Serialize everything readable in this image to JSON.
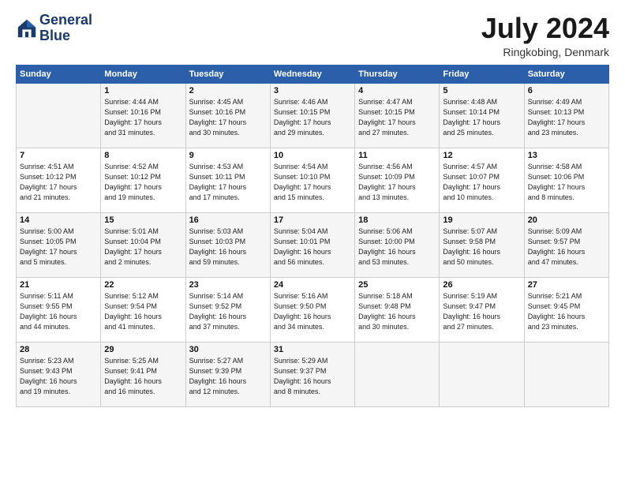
{
  "logo": {
    "line1": "General",
    "line2": "Blue"
  },
  "title": "July 2024",
  "location": "Ringkobing, Denmark",
  "header_days": [
    "Sunday",
    "Monday",
    "Tuesday",
    "Wednesday",
    "Thursday",
    "Friday",
    "Saturday"
  ],
  "weeks": [
    [
      {
        "day": "",
        "info": ""
      },
      {
        "day": "1",
        "info": "Sunrise: 4:44 AM\nSunset: 10:16 PM\nDaylight: 17 hours\nand 31 minutes."
      },
      {
        "day": "2",
        "info": "Sunrise: 4:45 AM\nSunset: 10:16 PM\nDaylight: 17 hours\nand 30 minutes."
      },
      {
        "day": "3",
        "info": "Sunrise: 4:46 AM\nSunset: 10:15 PM\nDaylight: 17 hours\nand 29 minutes."
      },
      {
        "day": "4",
        "info": "Sunrise: 4:47 AM\nSunset: 10:15 PM\nDaylight: 17 hours\nand 27 minutes."
      },
      {
        "day": "5",
        "info": "Sunrise: 4:48 AM\nSunset: 10:14 PM\nDaylight: 17 hours\nand 25 minutes."
      },
      {
        "day": "6",
        "info": "Sunrise: 4:49 AM\nSunset: 10:13 PM\nDaylight: 17 hours\nand 23 minutes."
      }
    ],
    [
      {
        "day": "7",
        "info": "Sunrise: 4:51 AM\nSunset: 10:12 PM\nDaylight: 17 hours\nand 21 minutes."
      },
      {
        "day": "8",
        "info": "Sunrise: 4:52 AM\nSunset: 10:12 PM\nDaylight: 17 hours\nand 19 minutes."
      },
      {
        "day": "9",
        "info": "Sunrise: 4:53 AM\nSunset: 10:11 PM\nDaylight: 17 hours\nand 17 minutes."
      },
      {
        "day": "10",
        "info": "Sunrise: 4:54 AM\nSunset: 10:10 PM\nDaylight: 17 hours\nand 15 minutes."
      },
      {
        "day": "11",
        "info": "Sunrise: 4:56 AM\nSunset: 10:09 PM\nDaylight: 17 hours\nand 13 minutes."
      },
      {
        "day": "12",
        "info": "Sunrise: 4:57 AM\nSunset: 10:07 PM\nDaylight: 17 hours\nand 10 minutes."
      },
      {
        "day": "13",
        "info": "Sunrise: 4:58 AM\nSunset: 10:06 PM\nDaylight: 17 hours\nand 8 minutes."
      }
    ],
    [
      {
        "day": "14",
        "info": "Sunrise: 5:00 AM\nSunset: 10:05 PM\nDaylight: 17 hours\nand 5 minutes."
      },
      {
        "day": "15",
        "info": "Sunrise: 5:01 AM\nSunset: 10:04 PM\nDaylight: 17 hours\nand 2 minutes."
      },
      {
        "day": "16",
        "info": "Sunrise: 5:03 AM\nSunset: 10:03 PM\nDaylight: 16 hours\nand 59 minutes."
      },
      {
        "day": "17",
        "info": "Sunrise: 5:04 AM\nSunset: 10:01 PM\nDaylight: 16 hours\nand 56 minutes."
      },
      {
        "day": "18",
        "info": "Sunrise: 5:06 AM\nSunset: 10:00 PM\nDaylight: 16 hours\nand 53 minutes."
      },
      {
        "day": "19",
        "info": "Sunrise: 5:07 AM\nSunset: 9:58 PM\nDaylight: 16 hours\nand 50 minutes."
      },
      {
        "day": "20",
        "info": "Sunrise: 5:09 AM\nSunset: 9:57 PM\nDaylight: 16 hours\nand 47 minutes."
      }
    ],
    [
      {
        "day": "21",
        "info": "Sunrise: 5:11 AM\nSunset: 9:55 PM\nDaylight: 16 hours\nand 44 minutes."
      },
      {
        "day": "22",
        "info": "Sunrise: 5:12 AM\nSunset: 9:54 PM\nDaylight: 16 hours\nand 41 minutes."
      },
      {
        "day": "23",
        "info": "Sunrise: 5:14 AM\nSunset: 9:52 PM\nDaylight: 16 hours\nand 37 minutes."
      },
      {
        "day": "24",
        "info": "Sunrise: 5:16 AM\nSunset: 9:50 PM\nDaylight: 16 hours\nand 34 minutes."
      },
      {
        "day": "25",
        "info": "Sunrise: 5:18 AM\nSunset: 9:48 PM\nDaylight: 16 hours\nand 30 minutes."
      },
      {
        "day": "26",
        "info": "Sunrise: 5:19 AM\nSunset: 9:47 PM\nDaylight: 16 hours\nand 27 minutes."
      },
      {
        "day": "27",
        "info": "Sunrise: 5:21 AM\nSunset: 9:45 PM\nDaylight: 16 hours\nand 23 minutes."
      }
    ],
    [
      {
        "day": "28",
        "info": "Sunrise: 5:23 AM\nSunset: 9:43 PM\nDaylight: 16 hours\nand 19 minutes."
      },
      {
        "day": "29",
        "info": "Sunrise: 5:25 AM\nSunset: 9:41 PM\nDaylight: 16 hours\nand 16 minutes."
      },
      {
        "day": "30",
        "info": "Sunrise: 5:27 AM\nSunset: 9:39 PM\nDaylight: 16 hours\nand 12 minutes."
      },
      {
        "day": "31",
        "info": "Sunrise: 5:29 AM\nSunset: 9:37 PM\nDaylight: 16 hours\nand 8 minutes."
      },
      {
        "day": "",
        "info": ""
      },
      {
        "day": "",
        "info": ""
      },
      {
        "day": "",
        "info": ""
      }
    ]
  ]
}
